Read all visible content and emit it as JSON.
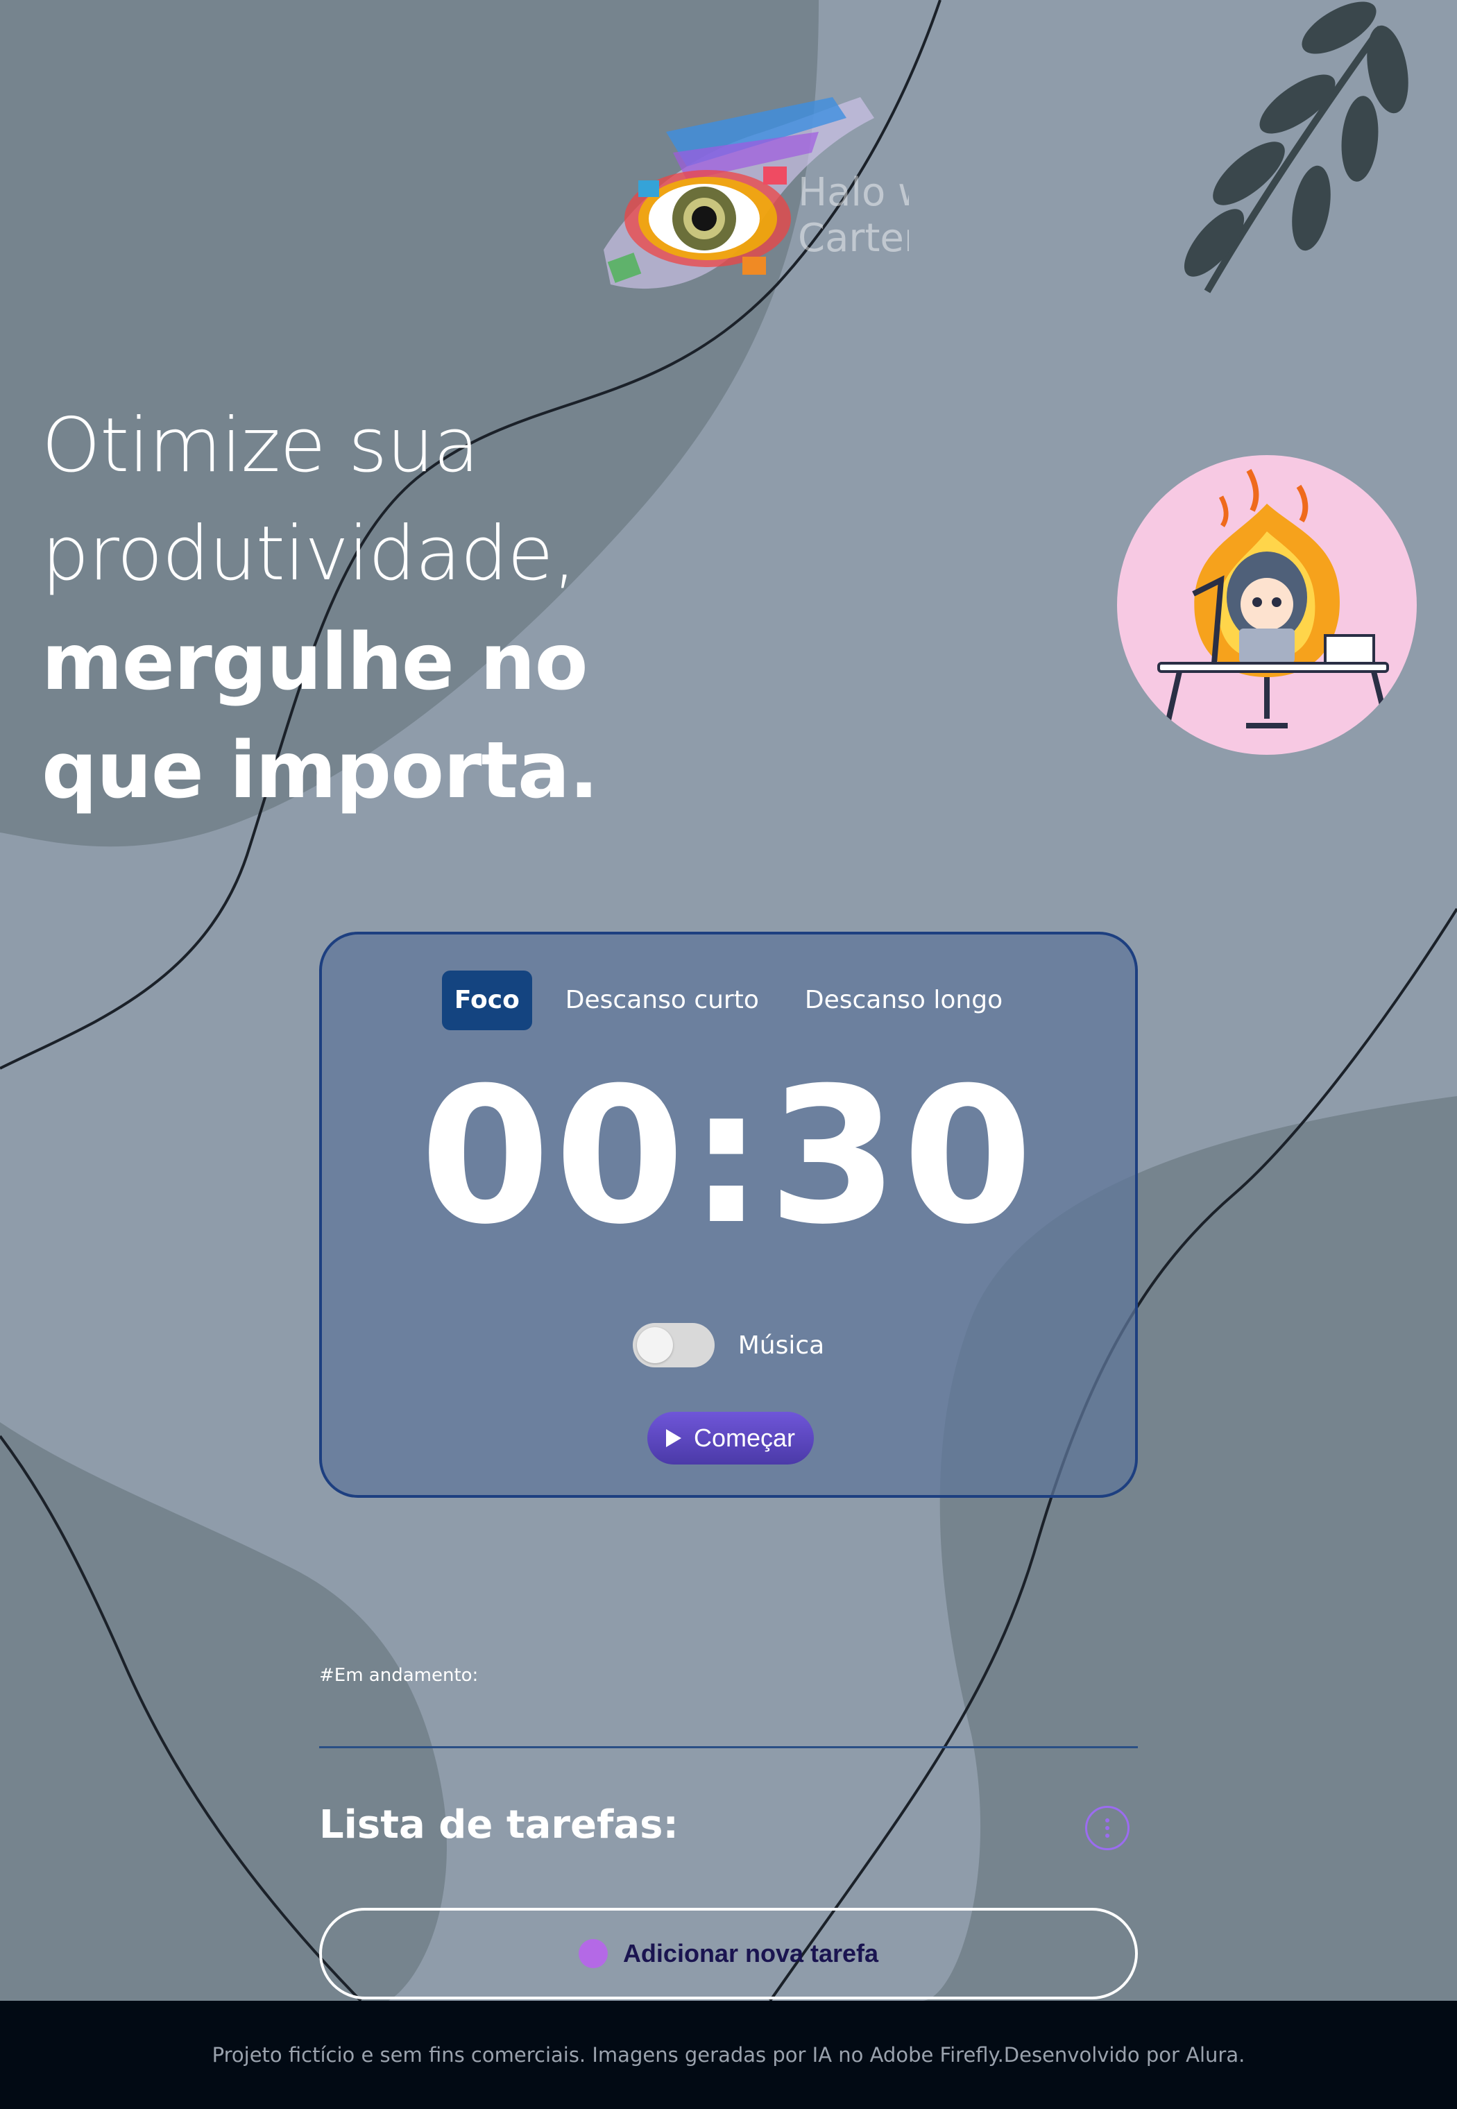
{
  "logo": {
    "lines": [
      "Halo wa",
      "Carter c"
    ]
  },
  "hero": {
    "line1": "Otimize sua",
    "line2": "produtividade,",
    "line3": "mergulhe no",
    "line4": "que importa."
  },
  "timer": {
    "modes": [
      {
        "label": "Foco",
        "active": true
      },
      {
        "label": "Descanso curto",
        "active": false
      },
      {
        "label": "Descanso longo",
        "active": false
      }
    ],
    "time": "00:30",
    "music_label": "Música",
    "music_on": false,
    "start_label": "Começar"
  },
  "tasks": {
    "in_progress_label": "#Em andamento:",
    "title": "Lista de tarefas:",
    "add_label": "Adicionar nova tarefa"
  },
  "footer": {
    "text": "Projeto fictício e sem fins comerciais. Imagens geradas por IA no Adobe Firefly.Desenvolvido por Alura."
  },
  "colors": {
    "background": "#8f9caa",
    "card": "#5e769a",
    "card_border": "#1d3f80",
    "active_tab": "#144480",
    "start_button": "#5a46c0",
    "accent_purple": "#9b6cf0",
    "footer_bg": "#020a14"
  }
}
